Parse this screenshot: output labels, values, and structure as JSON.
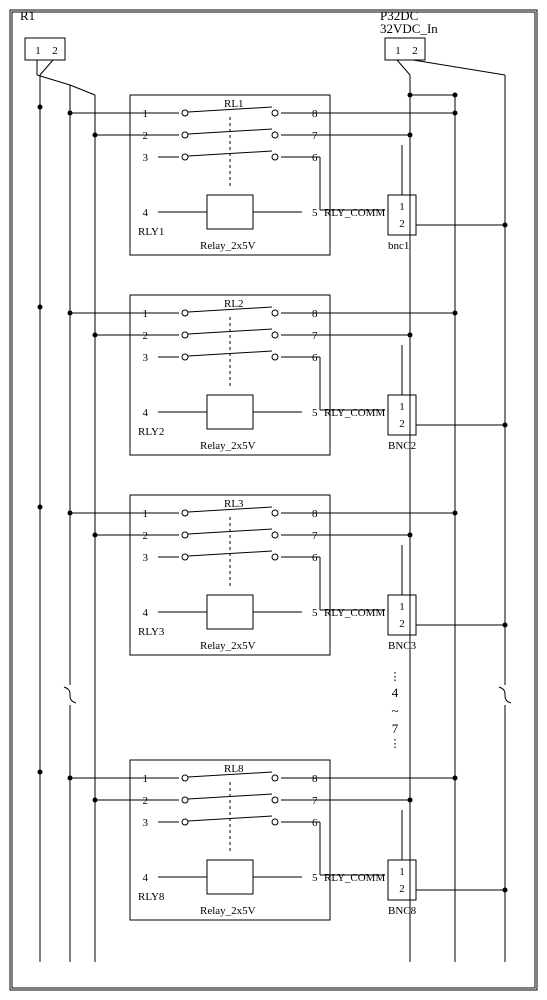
{
  "connectors": {
    "R1": {
      "ref": "R1",
      "pins": [
        "1",
        "2"
      ]
    },
    "P32": {
      "ref": "P32DC",
      "net": "32VDC_In",
      "pins": [
        "1",
        "2"
      ]
    }
  },
  "relays": [
    {
      "ref": "RLY1",
      "sw_ref": "RL1",
      "type": "Relay_2x5V",
      "coil_net": "RLY_COMM",
      "pins": {
        "sw": [
          "1",
          "2",
          "3",
          "8",
          "7",
          "6"
        ],
        "coil": [
          "4",
          "5"
        ]
      },
      "bnc": {
        "ref": "bnc1",
        "pins": [
          "1",
          "2"
        ]
      }
    },
    {
      "ref": "RLY2",
      "sw_ref": "RL2",
      "type": "Relay_2x5V",
      "coil_net": "RLY_COMM",
      "pins": {
        "sw": [
          "1",
          "2",
          "3",
          "8",
          "7",
          "6"
        ],
        "coil": [
          "4",
          "5"
        ]
      },
      "bnc": {
        "ref": "BNC2",
        "pins": [
          "1",
          "2"
        ]
      }
    },
    {
      "ref": "RLY3",
      "sw_ref": "RL3",
      "type": "Relay_2x5V",
      "coil_net": "RLY_COMM",
      "pins": {
        "sw": [
          "1",
          "2",
          "3",
          "8",
          "7",
          "6"
        ],
        "coil": [
          "4",
          "5"
        ]
      },
      "bnc": {
        "ref": "BNC3",
        "pins": [
          "1",
          "2"
        ]
      }
    },
    {
      "ref": "RLY8",
      "sw_ref": "RL8",
      "type": "Relay_2x5V",
      "coil_net": "RLY_COMM",
      "pins": {
        "sw": [
          "1",
          "2",
          "3",
          "8",
          "7",
          "6"
        ],
        "coil": [
          "4",
          "5"
        ]
      },
      "bnc": {
        "ref": "BNC8",
        "pins": [
          "1",
          "2"
        ]
      }
    }
  ],
  "ellipsis": "4\n~\n7"
}
